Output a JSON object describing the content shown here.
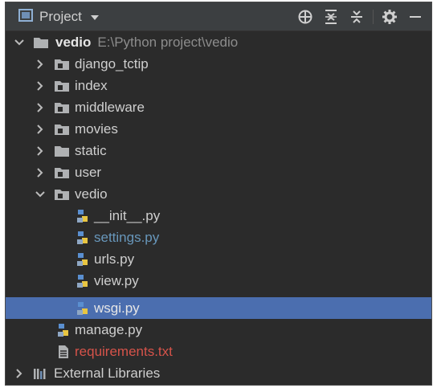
{
  "toolbar": {
    "title": "Project",
    "icons": [
      "crosshair-icon",
      "expand-all-icon",
      "collapse-all-icon",
      "gear-icon",
      "minimize-icon"
    ]
  },
  "tree": {
    "root": {
      "label": "vedio",
      "path": "E:\\Python project\\vedio"
    },
    "folders": [
      {
        "label": "django_tctip"
      },
      {
        "label": "index"
      },
      {
        "label": "middleware"
      },
      {
        "label": "movies"
      },
      {
        "label": "static"
      },
      {
        "label": "user"
      },
      {
        "label": "vedio"
      }
    ],
    "subfiles": [
      {
        "label": "__init__.py"
      },
      {
        "label": "settings.py"
      },
      {
        "label": "urls.py"
      },
      {
        "label": "view.py"
      },
      {
        "label": "wsgi.py"
      }
    ],
    "root_files": [
      {
        "label": "manage.py"
      },
      {
        "label": "requirements.txt"
      }
    ],
    "external": {
      "label": "External Libraries"
    }
  },
  "colors": {
    "background": "#2b2b2b",
    "toolbar": "#3c3f41",
    "selection": "#4b6eaf",
    "modified_file": "#6897bb",
    "unversioned_file": "#d6534a"
  }
}
